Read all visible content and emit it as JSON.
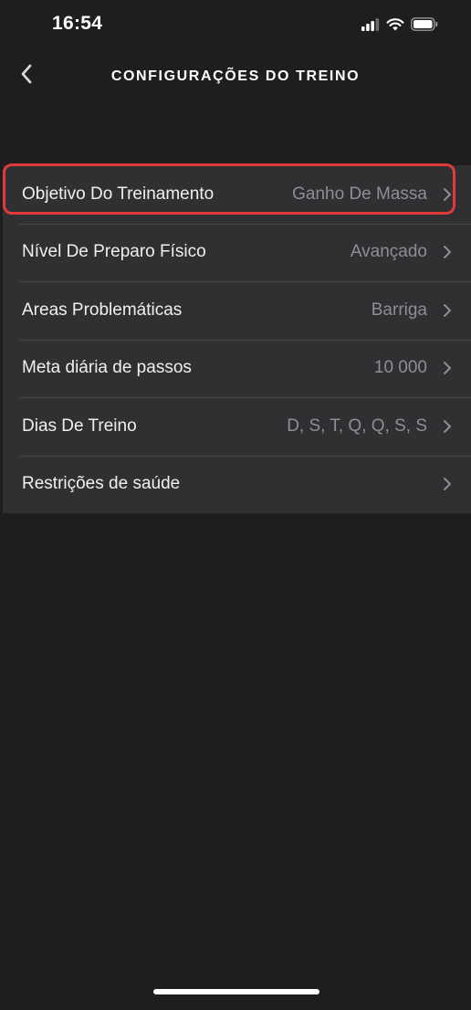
{
  "status_bar": {
    "time": "16:54",
    "icons": [
      "cellular-signal-icon",
      "wifi-icon",
      "battery-icon"
    ]
  },
  "nav": {
    "back_icon": "chevron-left-icon",
    "title": "CONFIGURAÇÕES DO TREINO"
  },
  "settings": {
    "rows": [
      {
        "label": "Objetivo Do Treinamento",
        "value": "Ganho De Massa",
        "highlighted": true
      },
      {
        "label": "Nível De Preparo Físico",
        "value": "Avançado"
      },
      {
        "label": "Areas Problemáticas",
        "value": "Barriga"
      },
      {
        "label": "Meta diária de passos",
        "value": "10 000"
      },
      {
        "label": "Dias De Treino",
        "value": "D, S, T, Q, Q, S, S"
      },
      {
        "label": "Restrições de saúde",
        "value": ""
      }
    ]
  },
  "colors": {
    "background": "#1e1e1e",
    "row_background": "#303033",
    "highlight": "#e23a3a",
    "value_text": "#8e8e93"
  }
}
